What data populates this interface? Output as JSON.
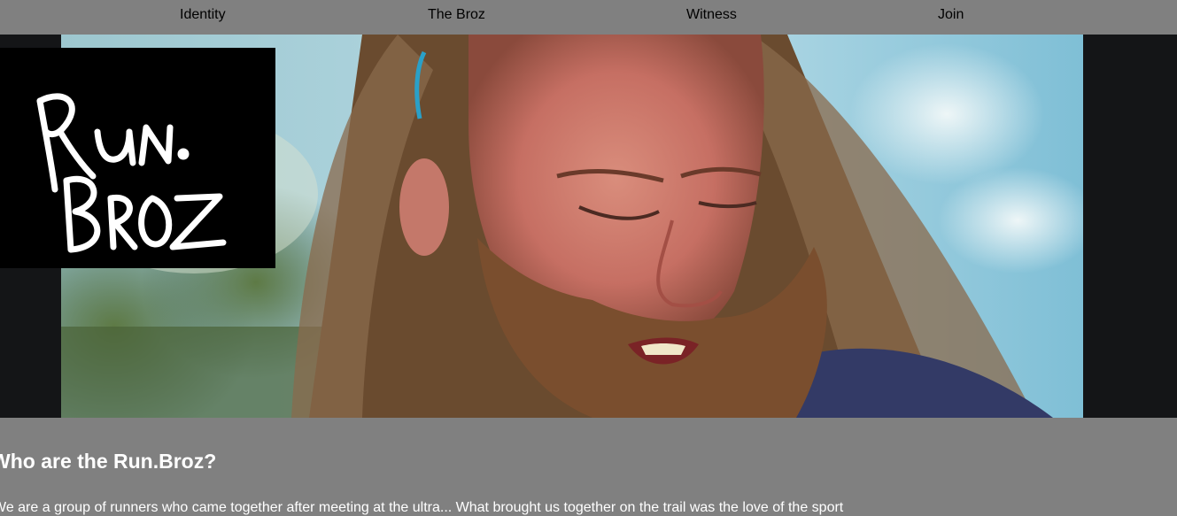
{
  "nav": {
    "items": [
      {
        "label": "Identity"
      },
      {
        "label": "The Broz"
      },
      {
        "label": "Witness"
      },
      {
        "label": "Join"
      }
    ]
  },
  "logo": {
    "text": "RUN. BROZ"
  },
  "hero": {
    "icon": "bearded-runner-photo"
  },
  "about": {
    "heading": "Who are the Run.Broz?",
    "body": "We are a group of runners who came together after meeting at the ultra... What brought us together on the trail was the love of the sport"
  },
  "colors": {
    "nav_bg": "#808080",
    "hero_bg": "#141517",
    "logo_bg": "#000000",
    "section_bg": "#808080",
    "heading_text": "#ffffff"
  }
}
